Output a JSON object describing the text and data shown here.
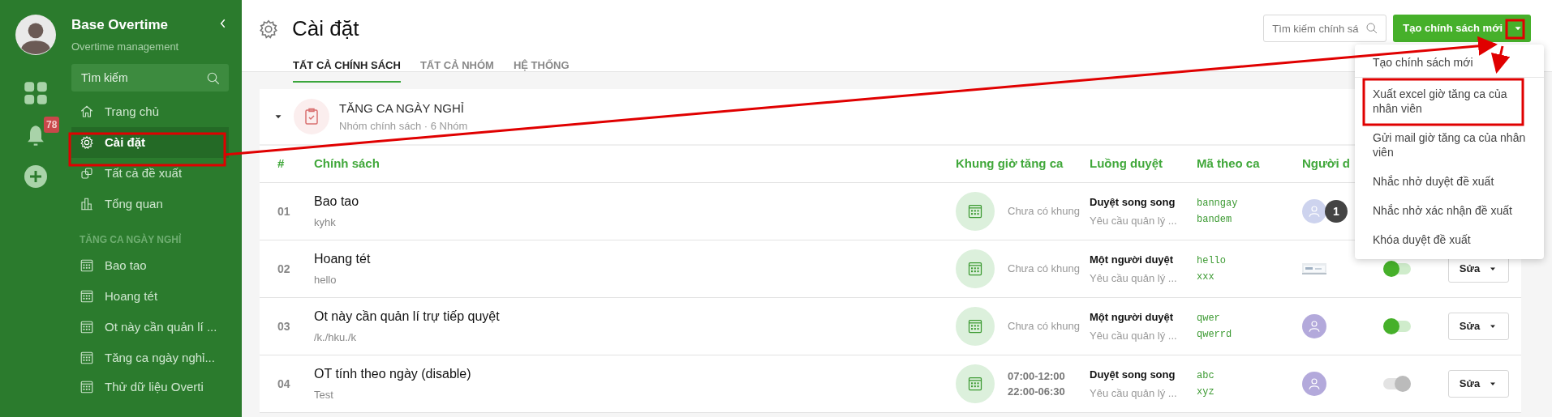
{
  "sidebar": {
    "app_title": "Base Overtime",
    "app_subtitle": "Overtime management",
    "notification_count": "78",
    "search": {
      "placeholder": "Tìm kiếm"
    },
    "nav": [
      {
        "label": "Trang chủ",
        "selected": false
      },
      {
        "label": "Cài đặt",
        "selected": true
      },
      {
        "label": "Tất cả đề xuất",
        "selected": false
      },
      {
        "label": "Tổng quan",
        "selected": false
      }
    ],
    "section_title": "TĂNG CA NGÀY NGHỈ",
    "groups": [
      {
        "label": "Bao tao"
      },
      {
        "label": "Hoang tét"
      },
      {
        "label": "Ot này cần quản lí ..."
      },
      {
        "label": "Tăng ca ngày nghỉ..."
      },
      {
        "label": "Thử dữ liệu Overti"
      }
    ]
  },
  "header": {
    "title": "Cài đặt",
    "tabs": [
      {
        "label": "TẤT CẢ CHÍNH SÁCH",
        "selected": true
      },
      {
        "label": "TẤT CẢ NHÓM",
        "selected": false
      },
      {
        "label": "HỆ THỐNG",
        "selected": false
      }
    ],
    "search": {
      "placeholder": "Tìm kiếm chính sá"
    },
    "create_button": "Tạo chính sách mới",
    "menu": [
      {
        "label": "Tạo chính sách mới",
        "divider_after": true
      },
      {
        "label": "Xuất excel giờ tăng ca của nhân viên",
        "divider_after": false
      },
      {
        "label": "Gửi mail giờ tăng ca của nhân viên",
        "divider_after": false
      },
      {
        "label": "Nhắc nhở duyệt đề xuất",
        "divider_after": false
      },
      {
        "label": "Nhắc nhở xác nhận đề xuất",
        "divider_after": false
      },
      {
        "label": "Khóa duyệt đề xuất",
        "divider_after": false
      }
    ]
  },
  "group_card": {
    "expanded": true,
    "title": "TĂNG CA NGÀY NGHỈ",
    "subtitle": "Nhóm chính sách · 6 Nhóm",
    "columns": [
      "#",
      "Chính sách",
      "Khung giờ tăng ca",
      "Luồng duyệt",
      "Mã theo ca",
      "Người d"
    ],
    "rows": [
      {
        "num": "01",
        "name": "Bao tao",
        "desc": "kyhk",
        "schedule": {
          "kind": "empty",
          "lines": [
            "Chưa có khung"
          ]
        },
        "flow": "Duyệt song song",
        "flow_note": "Yêu cầu quản lý ...",
        "codes": [
          "banngay",
          "bandem"
        ],
        "approver": {
          "kind": "avatar",
          "count": "1"
        }
      },
      {
        "num": "02",
        "name": "Hoang tét",
        "desc": "hello",
        "schedule": {
          "kind": "empty",
          "lines": [
            "Chưa có khung"
          ]
        },
        "flow": "Một người duyệt",
        "flow_note": "Yêu cầu quản lý ...",
        "codes": [
          "hello",
          "xxx"
        ],
        "approver": {
          "kind": "picture"
        },
        "enabled": true,
        "edit_label": "Sửa"
      },
      {
        "num": "03",
        "name": "Ot này cần quản lí trự tiếp quyệt",
        "desc": "/k./hku./k",
        "schedule": {
          "kind": "empty",
          "lines": [
            "Chưa có khung"
          ]
        },
        "flow": "Một người duyệt",
        "flow_note": "Yêu cầu quản lý ...",
        "codes": [
          "qwer",
          "qwerrd"
        ],
        "approver": {
          "kind": "avatar"
        },
        "enabled": true,
        "edit_label": "Sửa"
      },
      {
        "num": "04",
        "name": "OT tính theo ngày (disable)",
        "desc": "Test",
        "schedule": {
          "kind": "set",
          "lines": [
            "07:00-12:00",
            "22:00-06:30"
          ]
        },
        "flow": "Duyệt song song",
        "flow_note": "Yêu cầu quản lý ...",
        "codes": [
          "abc",
          "xyz"
        ],
        "approver": {
          "kind": "avatar"
        },
        "enabled": false,
        "edit_label": "Sửa"
      }
    ]
  }
}
